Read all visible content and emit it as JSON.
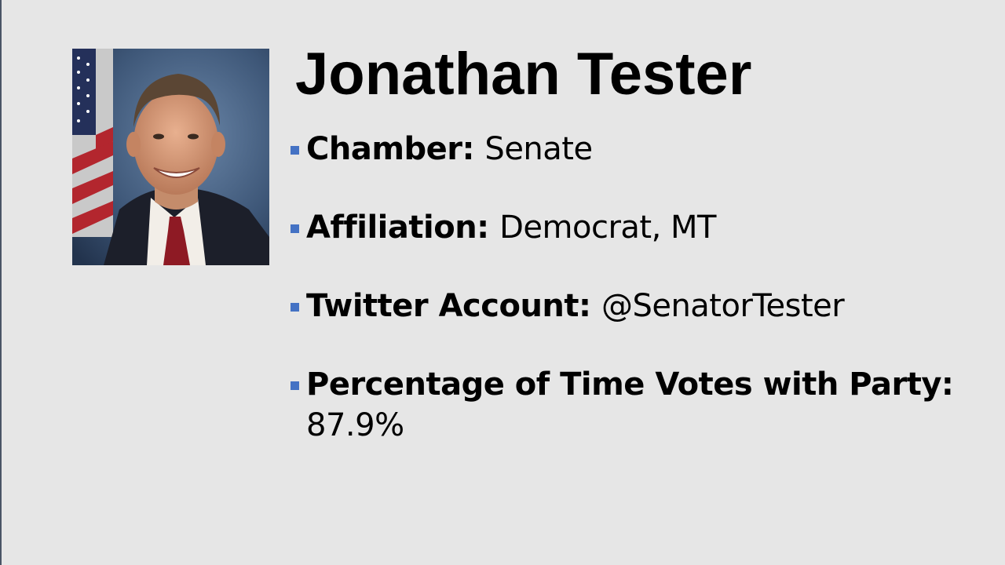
{
  "slide": {
    "title": "Jonathan Tester",
    "bullets": [
      {
        "label": "Chamber:",
        "value": "Senate"
      },
      {
        "label": "Affiliation:",
        "value": "Democrat, MT"
      },
      {
        "label": "Twitter Account:",
        "value": "@SenatorTester"
      },
      {
        "label": "Percentage of Time Votes with Party:",
        "value": "87.9%"
      }
    ]
  },
  "colors": {
    "background": "#e6e6e6",
    "bullet_marker": "#4472c4",
    "text": "#000000"
  },
  "icons": {
    "bullet": "square-bullet-icon",
    "portrait": "portrait-photo"
  }
}
